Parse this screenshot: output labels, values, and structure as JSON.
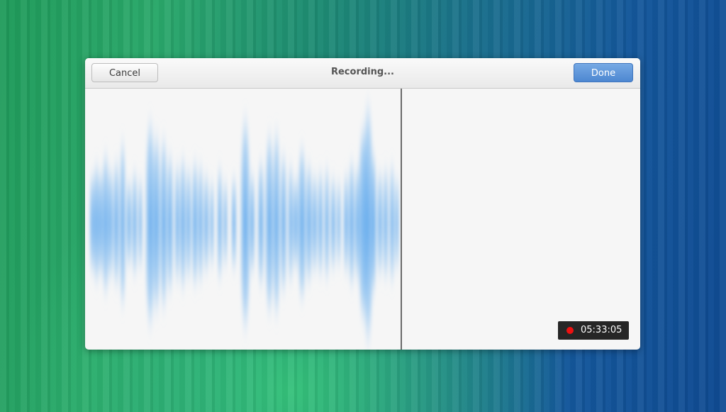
{
  "dialog": {
    "title": "Recording...",
    "cancel_label": "Cancel",
    "done_label": "Done"
  },
  "timer": {
    "elapsed": "05:33:05"
  },
  "colors": {
    "accent": "#5a92da",
    "waveform": "#5aa5ec",
    "recording_dot": "#ee1111"
  }
}
